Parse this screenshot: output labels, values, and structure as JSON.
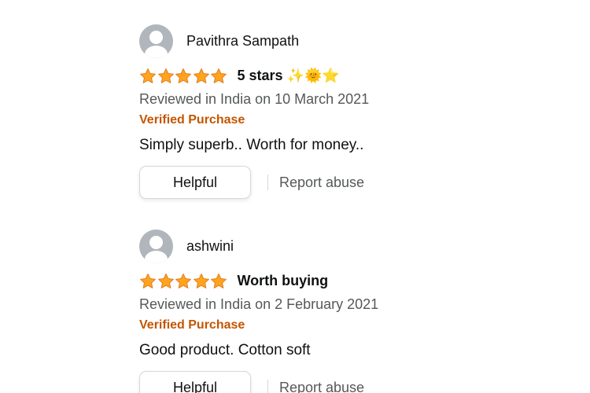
{
  "reviews": [
    {
      "reviewer": "Pavithra Sampath",
      "rating": 5,
      "rating_max": 5,
      "title": "5 stars ✨🌞⭐",
      "date": "Reviewed in India on 10 March 2021",
      "verified": "Verified Purchase",
      "body": "Simply superb.. Worth for money..",
      "helpful_label": "Helpful",
      "report_label": "Report abuse"
    },
    {
      "reviewer": "ashwini",
      "rating": 5,
      "rating_max": 5,
      "title": "Worth buying",
      "date": "Reviewed in India on 2 February 2021",
      "verified": "Verified Purchase",
      "body": "Good product. Cotton soft",
      "helpful_label": "Helpful",
      "report_label": "Report abuse"
    }
  ],
  "colors": {
    "star_fill": "#ffa41c",
    "star_stroke": "#de7921",
    "verified": "#c45500",
    "secondary_text": "#565959",
    "primary_text": "#0f1111"
  },
  "icons": {
    "avatar": "default-user-avatar-icon",
    "star": "star-filled-icon"
  }
}
